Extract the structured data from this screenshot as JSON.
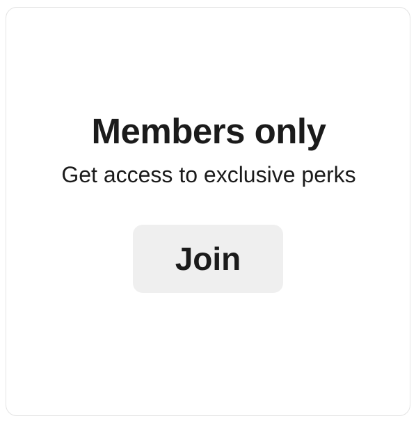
{
  "card": {
    "title": "Members only",
    "subtitle": "Get access to exclusive perks",
    "join_label": "Join"
  },
  "colors": {
    "text": "#1b1b1b",
    "button_bg": "#efefef",
    "border": "#e3e3e3",
    "background": "#ffffff"
  }
}
